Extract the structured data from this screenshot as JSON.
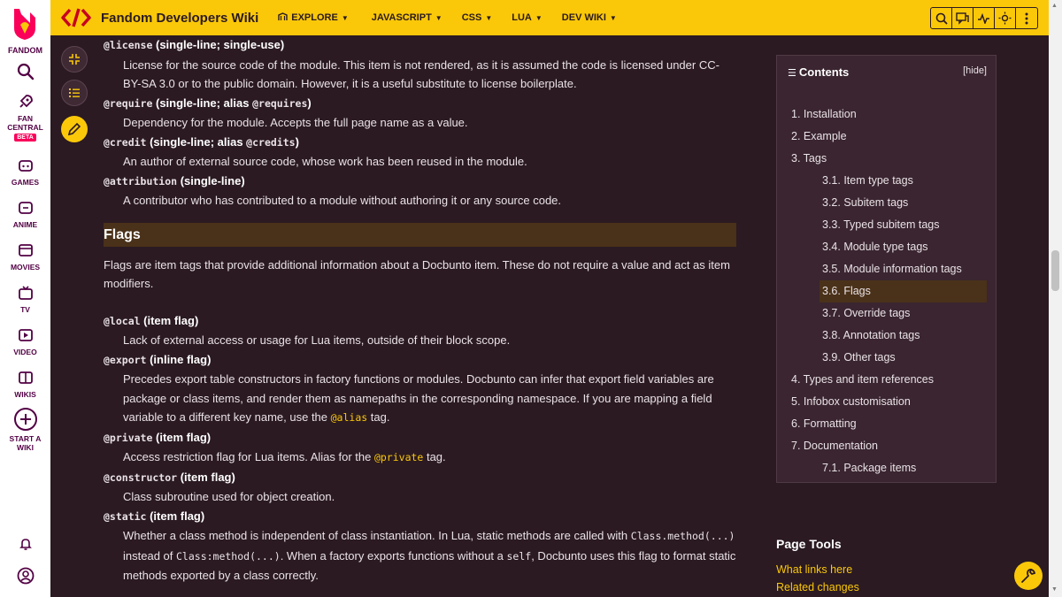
{
  "global_nav": {
    "logo_text": "FANDOM",
    "items": [
      {
        "label": "FAN\nCENTRAL",
        "icon": "rocket-icon"
      },
      {
        "label": "GAMES",
        "icon": "gamepad-icon"
      },
      {
        "label": "ANIME",
        "icon": "anime-icon"
      },
      {
        "label": "MOVIES",
        "icon": "movies-icon"
      },
      {
        "label": "TV",
        "icon": "tv-icon"
      },
      {
        "label": "VIDEO",
        "icon": "video-icon"
      },
      {
        "label": "WIKIS",
        "icon": "book-icon"
      },
      {
        "label": "START A\nWIKI",
        "icon": "plus-circle-icon"
      }
    ],
    "beta": "BETA"
  },
  "header": {
    "wiki_name": "Fandom Developers Wiki",
    "tabs": [
      {
        "label": "EXPLORE",
        "has_icon": true
      },
      {
        "label": "JAVASCRIPT"
      },
      {
        "label": "CSS"
      },
      {
        "label": "LUA"
      },
      {
        "label": "DEV WIKI"
      }
    ]
  },
  "content": {
    "entries_top": [
      {
        "tag": "@license",
        "desc": " (single-line; single-use)",
        "body": "License for the source code of the module. This item is not rendered, as it is assumed the code is licensed under CC-BY-SA 3.0 or to the public domain. However, it is a useful substitute to license boilerplate."
      },
      {
        "tag": "@require",
        "desc": " (single-line; alias ",
        "alias": "@requires",
        "desc_end": ")",
        "body": "Dependency for the module. Accepts the full page name as a value."
      },
      {
        "tag": "@credit",
        "desc": " (single-line; alias ",
        "alias": "@credits",
        "desc_end": ")",
        "body": "An author of external source code, whose work has been reused in the module."
      },
      {
        "tag": "@attribution",
        "desc": " (single-line)",
        "body": "A contributor who has contributed to a module without authoring it or any source code."
      }
    ],
    "section_title": "Flags",
    "intro": "Flags are item tags that provide additional information about a Docbunto item. These do not require a value and act as item modifiers.",
    "flags": {
      "local": {
        "tag": "@local",
        "desc": " (item flag)",
        "body": "Lack of external access or usage for Lua items, outside of their block scope."
      },
      "export": {
        "tag": "@export",
        "desc": " (inline flag)",
        "body1": "Precedes export table constructors in factory functions or modules. Docbunto can infer that export field variables are package or class items, and render them as namepaths in the corresponding namespace. If you are mapping a field variable to a different key name, use the ",
        "code": "@alias",
        "body2": " tag."
      },
      "private": {
        "tag": "@private",
        "desc": " (item flag)",
        "body1": "Access restriction flag for Lua items. Alias for the ",
        "code": "@private",
        "body2": " tag."
      },
      "constructor": {
        "tag": "@constructor",
        "desc": " (item flag)",
        "body": "Class subroutine used for object creation."
      },
      "static": {
        "tag": "@static",
        "desc": " (item flag)",
        "body1": "Whether a class method is independent of class instantiation. In Lua, static methods are called with ",
        "code1": "Class.method(...)",
        "body2": " instead of ",
        "code2": "Class:method(...)",
        "body3": ". When a factory exports functions without a ",
        "code3": "self",
        "body4": ", Docbunto uses this flag to format static methods exported by a class correctly."
      }
    }
  },
  "toc": {
    "title": "Contents",
    "hide": "[hide]",
    "items": [
      {
        "label": "1. Installation",
        "level": 1
      },
      {
        "label": "2. Example",
        "level": 1
      },
      {
        "label": "3. Tags",
        "level": 1
      },
      {
        "label": "3.1. Item type tags",
        "level": 2
      },
      {
        "label": "3.2. Subitem tags",
        "level": 2
      },
      {
        "label": "3.3. Typed subitem tags",
        "level": 2
      },
      {
        "label": "3.4. Module type tags",
        "level": 2
      },
      {
        "label": "3.5. Module information tags",
        "level": 2
      },
      {
        "label": "3.6. Flags",
        "level": 2,
        "active": true
      },
      {
        "label": "3.7. Override tags",
        "level": 2
      },
      {
        "label": "3.8. Annotation tags",
        "level": 2
      },
      {
        "label": "3.9. Other tags",
        "level": 2
      },
      {
        "label": "4. Types and item references",
        "level": 1
      },
      {
        "label": "5. Infobox customisation",
        "level": 1
      },
      {
        "label": "6. Formatting",
        "level": 1
      },
      {
        "label": "7. Documentation",
        "level": 1
      },
      {
        "label": "7.1. Package items",
        "level": 2
      }
    ]
  },
  "page_tools": {
    "title": "Page Tools",
    "link1": "What links here",
    "link2": "Related changes"
  },
  "colors": {
    "accent": "#fac809",
    "brand": "#fa005a",
    "background": "#2b1a22"
  }
}
